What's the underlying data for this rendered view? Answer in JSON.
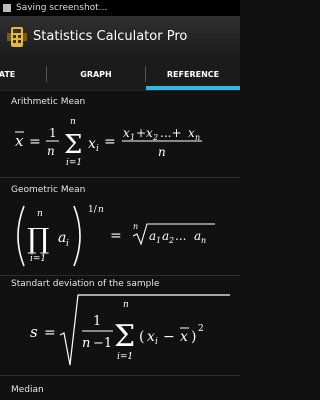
{
  "status_bar": {
    "notification": "Saving screenshot..."
  },
  "app": {
    "title": "Statistics Calculator Pro"
  },
  "tabs": [
    {
      "label": "ATE",
      "active": false
    },
    {
      "label": "GRAPH",
      "active": false
    },
    {
      "label": "REFERENCE",
      "active": true
    }
  ],
  "colors": {
    "accent": "#33b5e5",
    "background": "#111111"
  },
  "reference": {
    "sections": [
      {
        "title": "Arithmetic Mean"
      },
      {
        "title": "Geometric Mean"
      },
      {
        "title": "Standart deviation of the sample"
      },
      {
        "title": "Median"
      }
    ]
  }
}
